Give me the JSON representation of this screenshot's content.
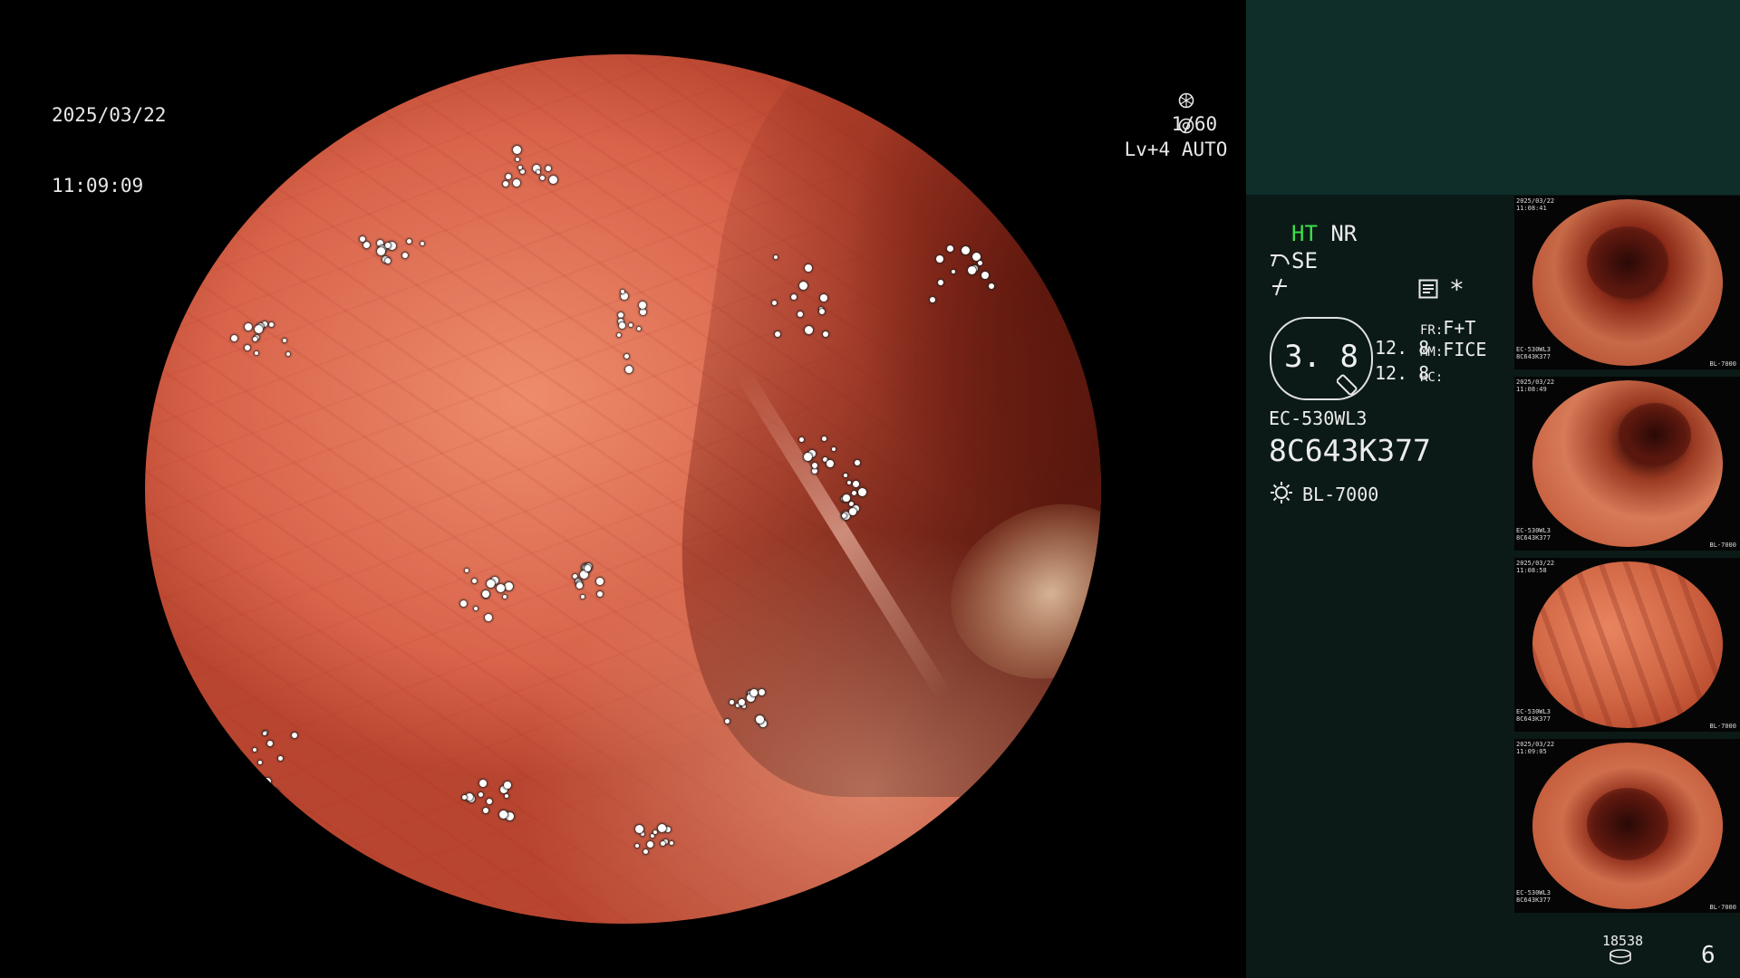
{
  "osd": {
    "date": "2025/03/22",
    "time": "11:09:09",
    "shutter": "1/60",
    "shutter_icon": "aperture-icon",
    "level": "Lv+4",
    "mode": "AUTO",
    "mode_icon": "iris-icon"
  },
  "panel": {
    "ht_label": "HT",
    "nr_label": "NR",
    "se_label": "SE",
    "memo_icon": "memo-icon",
    "star": "*",
    "magnification": "3. 8",
    "zoom_line1": "12. 8",
    "zoom_line2": "12. 8",
    "fr_label": "FR:",
    "fr_value": "F+T",
    "mm_label": "MM:",
    "mm_value": "FICE",
    "rc_label": "RC:",
    "scope_model": "EC-530WL3",
    "serial": "8C643K377",
    "light_source": "BL-7000",
    "counter": "18538",
    "capture_count": "6"
  },
  "thumbnails": [
    {
      "date": "2025/03/22",
      "time": "11:08:41",
      "model": "EC-530WL3",
      "serial": "8C643K377",
      "source": "BL-7000"
    },
    {
      "date": "2025/03/22",
      "time": "11:08:49",
      "model": "EC-530WL3",
      "serial": "8C643K377",
      "source": "BL-7000"
    },
    {
      "date": "2025/03/22",
      "time": "11:08:58",
      "model": "EC-530WL3",
      "serial": "8C643K377",
      "source": "BL-7000"
    },
    {
      "date": "2025/03/22",
      "time": "11:09:05",
      "model": "EC-530WL3",
      "serial": "8C643K377",
      "source": "BL-7000"
    }
  ],
  "colors": {
    "accent_green": "#3ee04a",
    "panel_bg": "#0b1a17",
    "panel_top_bg": "#0f2e2a",
    "mucosa": "#e0735a"
  }
}
